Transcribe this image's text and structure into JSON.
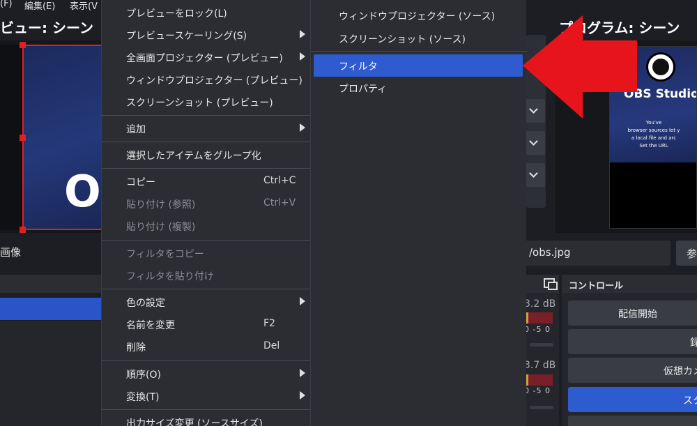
{
  "menubar": {
    "file": "(F)",
    "edit": "編集(E)",
    "view": "表示(V"
  },
  "preview": {
    "title": "ビュー: シーン",
    "big_char": "O"
  },
  "program": {
    "title": "プログラム: シーン",
    "obs_name": "OBS Studio",
    "lines": [
      "You've",
      "browser sources let y",
      "a local file and arc",
      "Set the URL"
    ]
  },
  "source_row": {
    "label": "画像",
    "path": "/obs.jpg",
    "browse": "参"
  },
  "context_menu": {
    "items": [
      {
        "label": "プレビューをロック(L)"
      },
      {
        "label": "プレビュースケーリング(S)",
        "submenu": true
      },
      {
        "label": "全画面プロジェクター (プレビュー)",
        "submenu": true
      },
      {
        "label": "ウィンドウプロジェクター (プレビュー)"
      },
      {
        "label": "スクリーンショット (プレビュー)"
      },
      {
        "label": "追加",
        "submenu": true
      },
      {
        "label": "選択したアイテムをグループ化"
      },
      {
        "label": "コピー",
        "shortcut": "Ctrl+C"
      },
      {
        "label": "貼り付け (参照)",
        "shortcut": "Ctrl+V",
        "disabled": true
      },
      {
        "label": "貼り付け (複製)",
        "disabled": true
      },
      {
        "label": "フィルタをコピー",
        "disabled": true
      },
      {
        "label": "フィルタを貼り付け",
        "disabled": true
      },
      {
        "label": "色の設定",
        "submenu": true
      },
      {
        "label": "名前を変更",
        "shortcut": "F2"
      },
      {
        "label": "削除",
        "shortcut": "Del"
      },
      {
        "label": "順序(O)",
        "submenu": true
      },
      {
        "label": "変換(T)",
        "submenu": true
      },
      {
        "label": "出力サイズ変更 (ソースサイズ)"
      }
    ]
  },
  "submenu": {
    "items": [
      {
        "label": "ウィンドウプロジェクター (ソース)"
      },
      {
        "label": "スクリーンショット (ソース)"
      },
      {
        "label": "フィルタ",
        "selected": true
      },
      {
        "label": "プロパティ"
      }
    ]
  },
  "mixer": {
    "rows": [
      {
        "db": "3.2 dB",
        "ticks": "0  -5  0"
      },
      {
        "db": "3.7 dB",
        "ticks": "0  -5  0"
      }
    ]
  },
  "controls": {
    "header": "コントロール",
    "start_stream": "配信開始",
    "record": "録",
    "virtual_cam": "仮想カメ",
    "studio": "スタ"
  },
  "colors": {
    "accent": "#2f5bd0",
    "arrow": "#e8141c",
    "selection": "#e02020"
  }
}
